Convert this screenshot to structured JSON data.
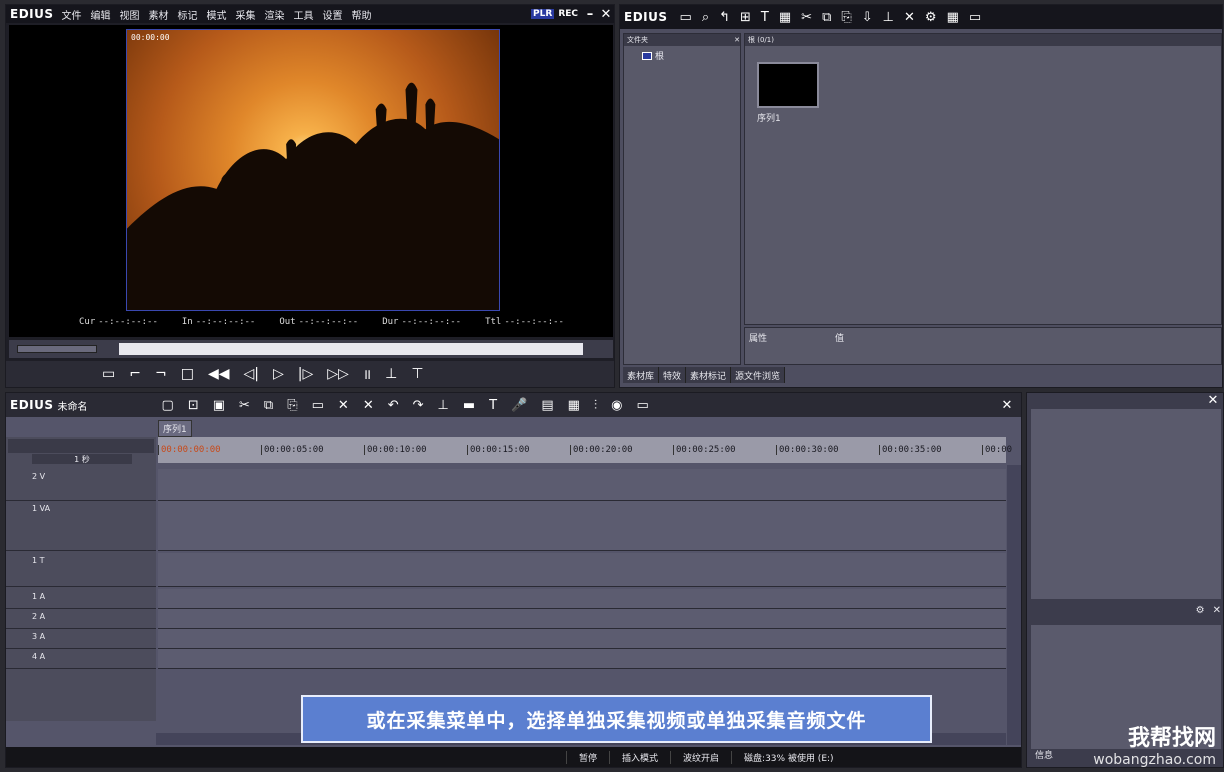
{
  "player": {
    "logo": "EDIUS",
    "menu": [
      "文件",
      "编辑",
      "视图",
      "素材",
      "标记",
      "模式",
      "采集",
      "渲染",
      "工具",
      "设置",
      "帮助"
    ],
    "plr": "PLR",
    "rec": "REC",
    "overlay_tc": "00:00:00",
    "timecodes": [
      {
        "label": "Cur",
        "value": "--:--:--:--"
      },
      {
        "label": "In",
        "value": "--:--:--:--"
      },
      {
        "label": "Out",
        "value": "--:--:--:--"
      },
      {
        "label": "Dur",
        "value": "--:--:--:--"
      },
      {
        "label": "Ttl",
        "value": "--:--:--:--"
      }
    ]
  },
  "bin": {
    "logo": "EDIUS",
    "folder_header": "文件夹",
    "root_folder": "根",
    "clip_header": "根 (0/1)",
    "clip_name": "序列1",
    "prop_col1": "属性",
    "prop_col2": "值",
    "tabs": [
      "素材库",
      "特效",
      "素材标记",
      "源文件浏览"
    ]
  },
  "timeline": {
    "logo": "EDIUS",
    "project_name": "未命名",
    "sequence_tab": "序列1",
    "scale": "1 秒",
    "ruler_ticks": [
      "00:00:00:00",
      "00:00:05:00",
      "00:00:10:00",
      "00:00:15:00",
      "00:00:20:00",
      "00:00:25:00",
      "00:00:30:00",
      "00:00:35:00",
      "00:00"
    ],
    "tracks": [
      "2 V",
      "1 VA",
      "1 T",
      "1 A",
      "2 A",
      "3 A",
      "4 A"
    ]
  },
  "status": {
    "state": "暂停",
    "mode": "插入模式",
    "ripple": "波纹开启",
    "disk": "磁盘:33% 被使用 (E:)"
  },
  "info": {
    "label": "信息"
  },
  "caption": "或在采集菜单中，选择单独采集视频或单独采集音频文件",
  "watermark": {
    "big": "我帮找网",
    "small": "wobangzhao.com"
  }
}
